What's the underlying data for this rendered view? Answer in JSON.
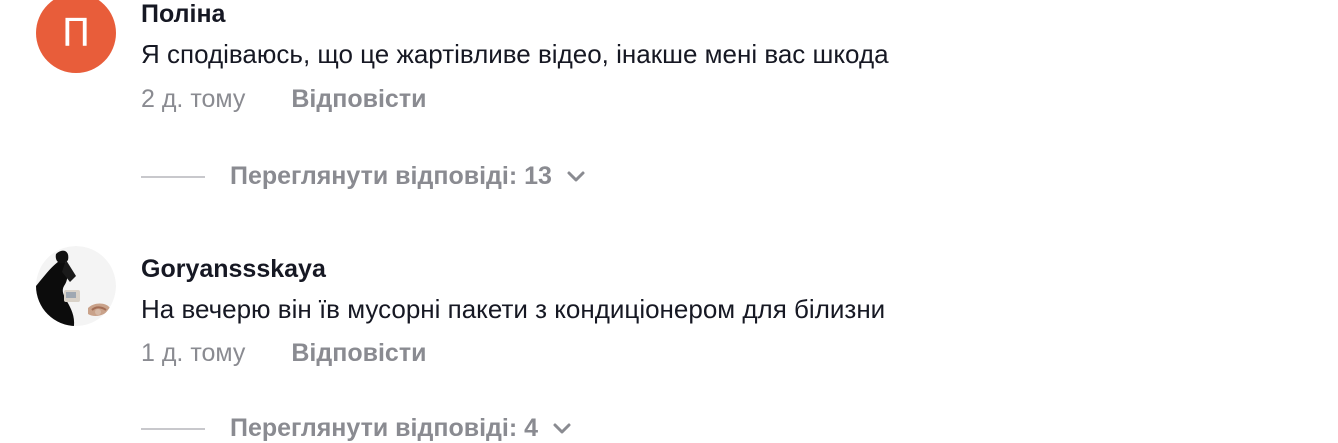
{
  "comments": [
    {
      "avatar_letter": "П",
      "avatar_color": "#e85d3a",
      "username": "Поліна",
      "text": "Я сподіваюсь, що це жартівливе відео, інакше мені вас шкода",
      "time": "2 д. тому",
      "reply_label": "Відповісти",
      "view_replies_label": "Переглянути відповіді: 13",
      "expand_icon": "chevron-down-icon"
    },
    {
      "avatar_image": "profile-photo",
      "username": "Goryanssskaya",
      "text": "На вечерю він їв мусорні пакети з кондиціонером для білизни",
      "time": "1 д. тому",
      "reply_label": "Відповісти",
      "view_replies_label": "Переглянути відповіді: 4",
      "expand_icon": "chevron-down-icon"
    }
  ],
  "colors": {
    "primary_text": "#161823",
    "secondary_text": "#8a8b91",
    "divider": "#c8c8cc"
  }
}
